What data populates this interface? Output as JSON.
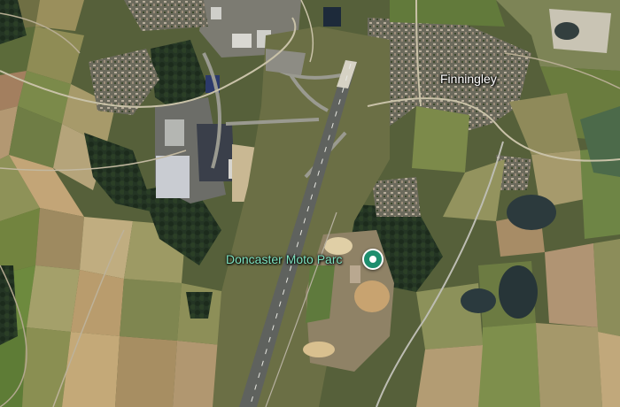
{
  "map": {
    "view": "satellite",
    "place_labels": {
      "town": "Finningley",
      "poi": "Doncaster Moto Parc"
    },
    "poi_marker": {
      "icon": "map-pin-icon",
      "color": "#1e8e6e",
      "label_color": "#7fe3c1"
    }
  }
}
